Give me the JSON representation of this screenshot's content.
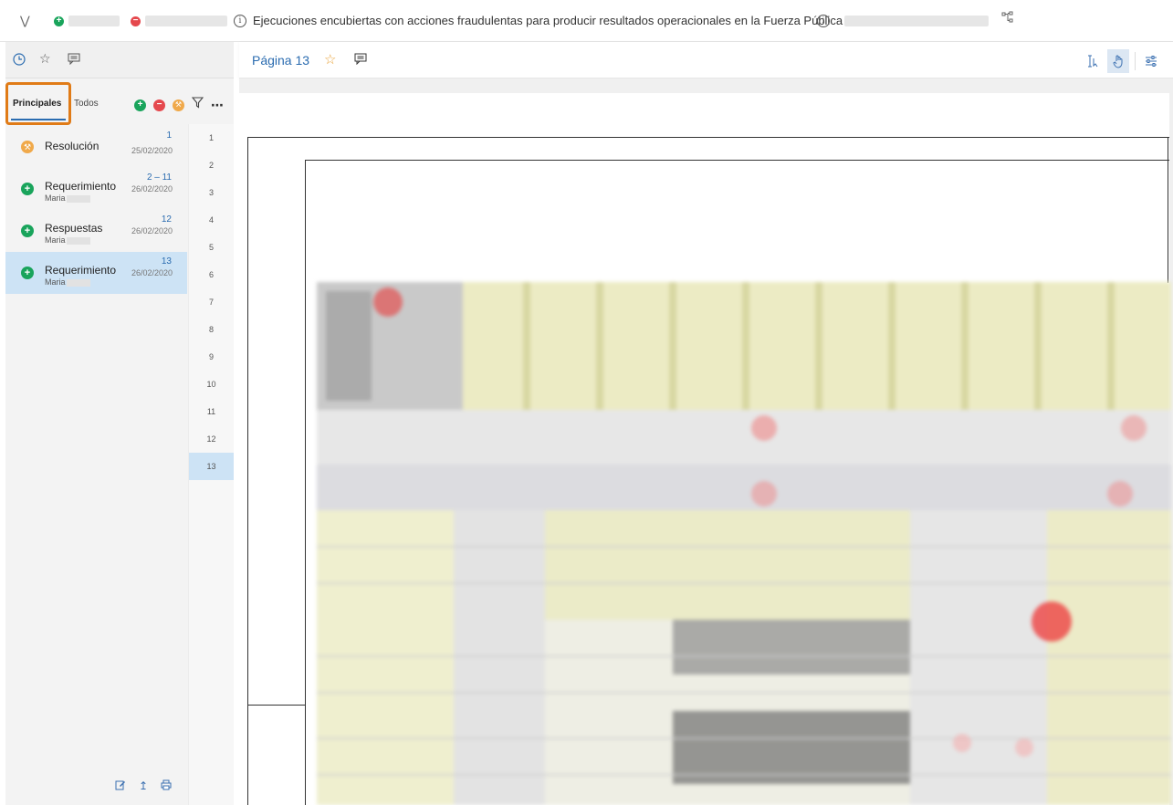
{
  "topbar": {
    "collapse_icon": "chevrons-down-icon",
    "title": "Ejecuciones encubiertas con acciones fraudulentas para producir resultados operacionales en la Fuerza Pública",
    "tree_icon": "hierarchy-icon"
  },
  "left_panel": {
    "icons": [
      "history-icon",
      "star-icon",
      "comment-icon"
    ],
    "tabs": [
      {
        "label": "Principales",
        "active": true
      },
      {
        "label": "Todos",
        "active": false
      }
    ],
    "entries": [
      {
        "title": "Resolución",
        "user": "",
        "pages": "1",
        "date": "25/02/2020",
        "type": "resolution",
        "color": "#f0a94a"
      },
      {
        "title": "Requerimiento",
        "user": "Maria",
        "pages": "2 – 11",
        "date": "26/02/2020",
        "type": "add",
        "color": "#19a45b"
      },
      {
        "title": "Respuestas",
        "user": "Maria",
        "pages": "12",
        "date": "26/02/2020",
        "type": "add",
        "color": "#19a45b"
      },
      {
        "title": "Requerimiento",
        "user": "Maria",
        "pages": "13",
        "date": "26/02/2020",
        "type": "add",
        "color": "#19a45b",
        "selected": true
      }
    ],
    "page_numbers": [
      "1",
      "2",
      "3",
      "4",
      "5",
      "6",
      "7",
      "8",
      "9",
      "10",
      "11",
      "12",
      "13"
    ],
    "selected_page": "13"
  },
  "viewer": {
    "page_label": "Página 13",
    "tools": [
      "text-select-icon",
      "hand-icon",
      "settings-sliders-icon"
    ]
  },
  "colors": {
    "accent": "#2b6cb0",
    "add": "#19a45b",
    "remove": "#e5484d",
    "resolution": "#f0a94a",
    "selected_bg": "#cde3f5",
    "highlight": "#e07b17"
  }
}
